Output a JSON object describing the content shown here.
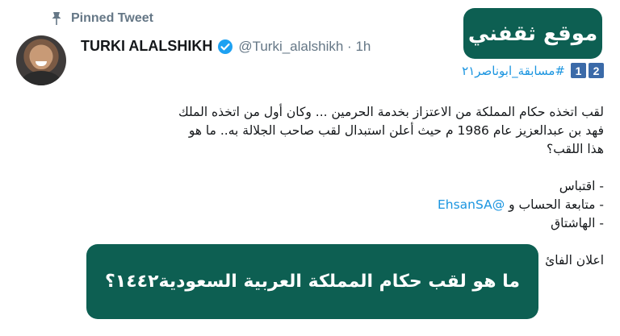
{
  "pinned": {
    "label": "Pinned Tweet",
    "icon": "pin-icon"
  },
  "user": {
    "name": "TURKI ALALSHIKH",
    "handle": "@Turki_alalshikh · 1h",
    "verified_icon": "verified-badge-icon",
    "accent": "#1da1f2"
  },
  "badge": {
    "text": "موقع ثقفني",
    "color": "#0d5f52"
  },
  "hashtag_line": {
    "numbers": [
      "2",
      "1"
    ],
    "hashtag": "#مسابقة_ابوناصر٢١"
  },
  "tweet": {
    "line1": "لقب اتخذه حكام المملكة من الاعتزاز بخدمة الحرمين ... وكان أول من اتخذه الملك",
    "line2": "فهد بن عبدالعزيز عام 1986 م حيث أعلن استبدال لقب صاحب الجلالة به.. ما هو",
    "line3": "هذا اللقب؟",
    "item1": "-  اقتباس",
    "item2_prefix": "- متابعة الحساب و ",
    "item2_mention": "@EhsanSA",
    "item3": "- الهاشتاق",
    "line_last": "اعلان الفائ"
  },
  "overlay": {
    "text": "ما هو لقب حكام المملكة العربية السعودية١٤٤٢؟"
  }
}
